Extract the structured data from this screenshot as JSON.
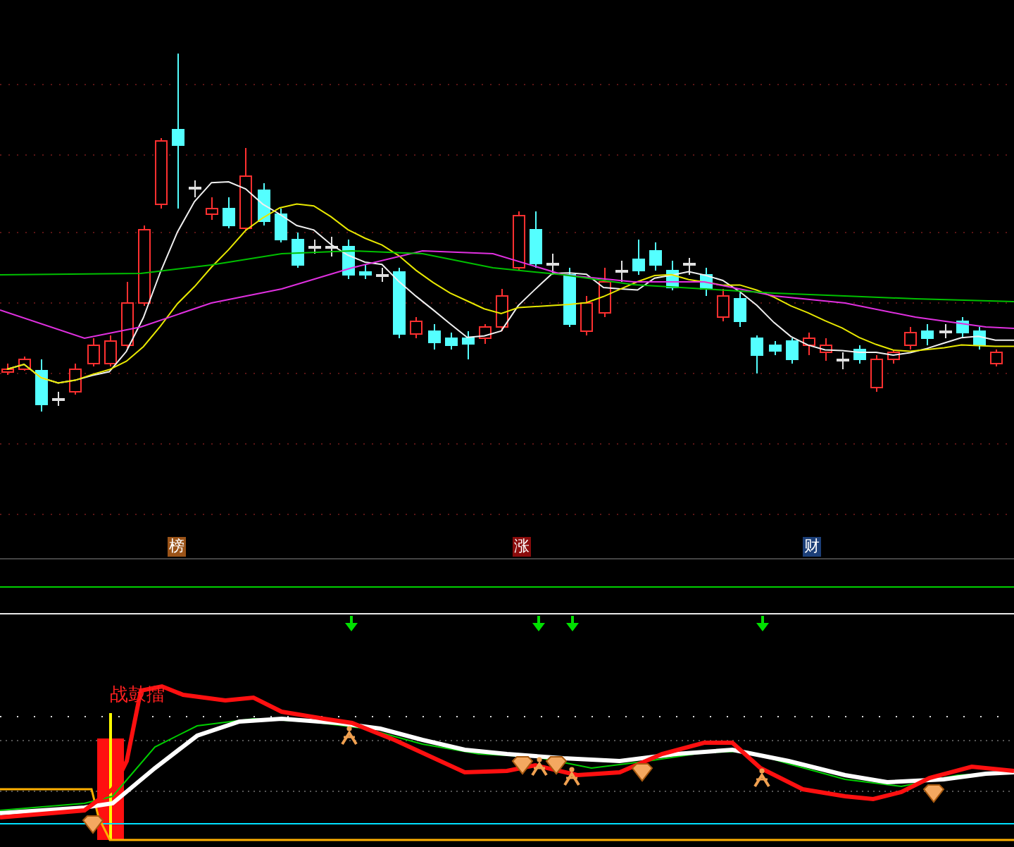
{
  "signal_badges": [
    {
      "label": "榜",
      "color": "#9a5318"
    },
    {
      "label": "涨",
      "color": "#8a0c0c"
    },
    {
      "label": "财",
      "color": "#1c3f78"
    }
  ],
  "indicator": {
    "label": "战鼓擂"
  }
}
